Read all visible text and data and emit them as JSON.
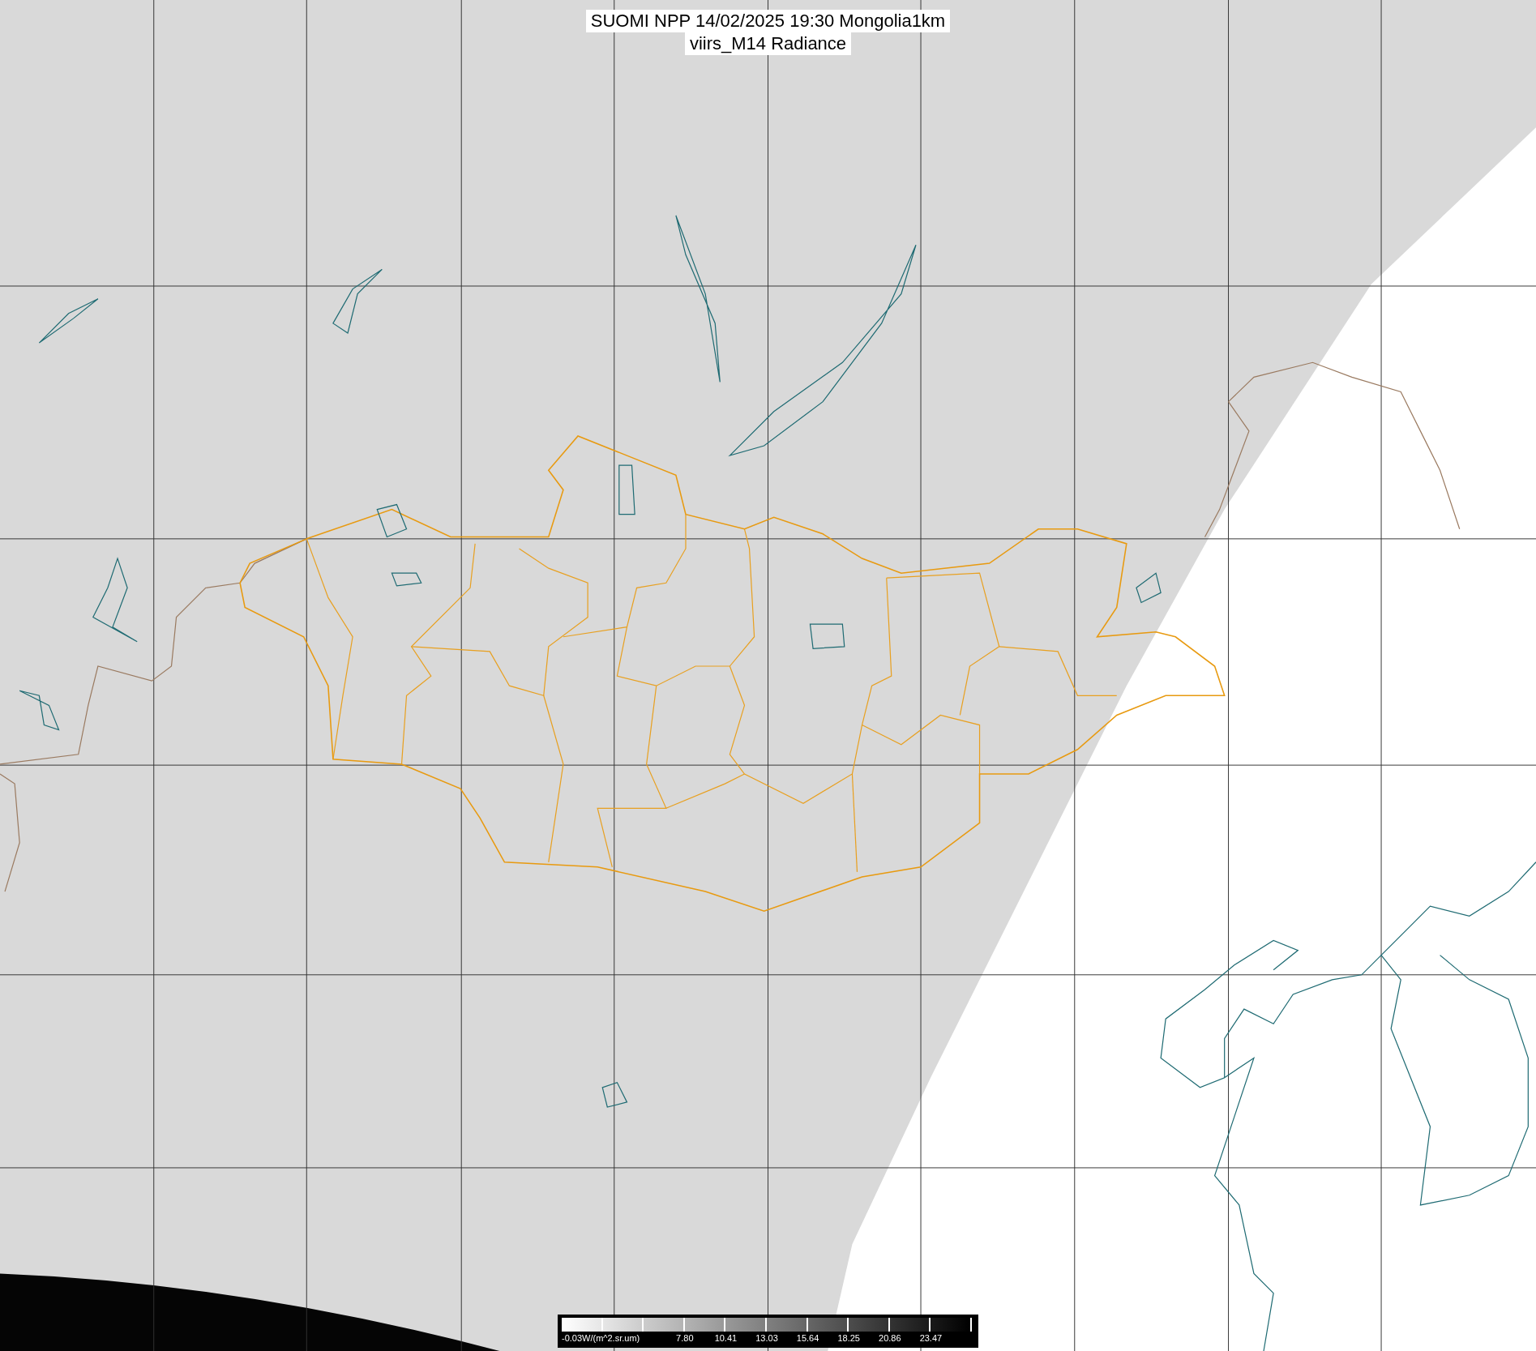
{
  "title": {
    "lines": [
      "SUOMI NPP 14/02/2025 19:30 Mongolia1km",
      "viirs_M14 Radiance"
    ]
  },
  "colorbar": {
    "labels": [
      "-0.03W/(m^2.sr.um)",
      "7.80",
      "10.41",
      "13.03",
      "15.64",
      "18.25",
      "20.86",
      "23.47"
    ]
  }
}
